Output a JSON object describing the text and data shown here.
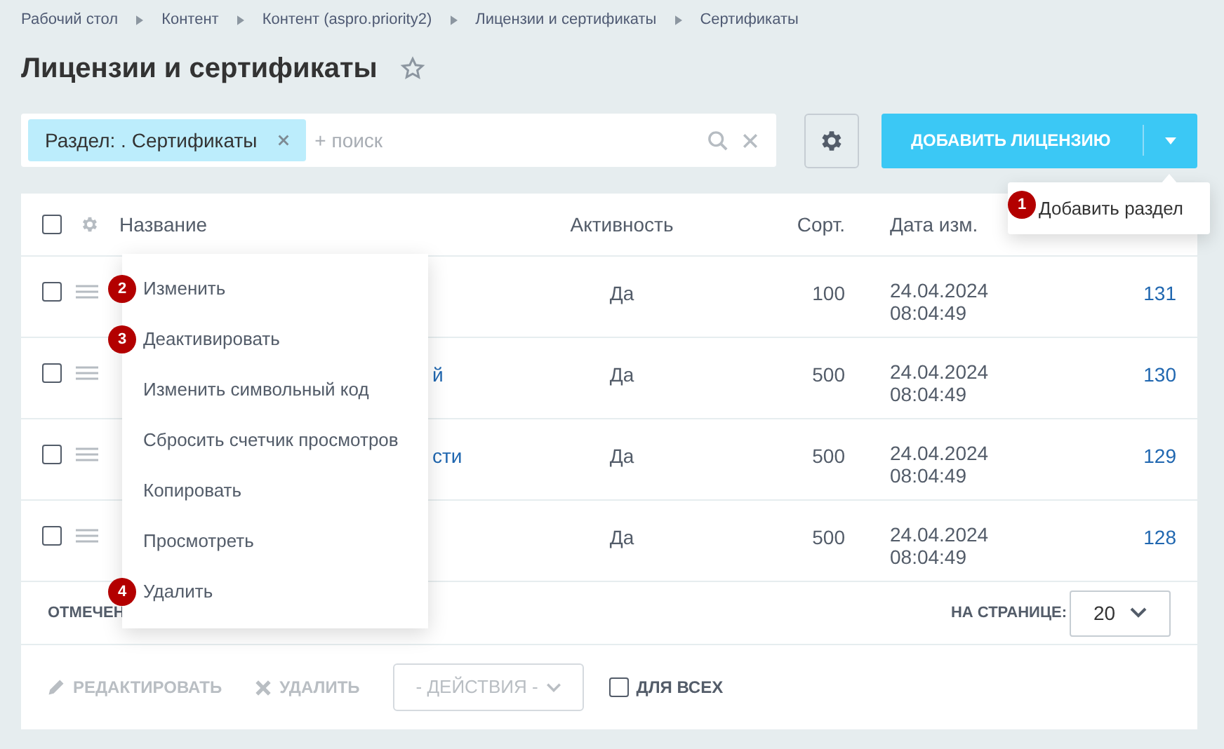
{
  "breadcrumbs": [
    "Рабочий стол",
    "Контент",
    "Контент (aspro.priority2)",
    "Лицензии и сертификаты",
    "Сертификаты"
  ],
  "title": "Лицензии и сертификаты",
  "filter": {
    "tag": "Раздел: . Сертификаты",
    "placeholder": "+ поиск"
  },
  "add_button": {
    "label": "ДОБАВИТЬ ЛИЦЕНЗИЮ"
  },
  "add_menu": [
    {
      "label": "Добавить раздел",
      "badge": "1"
    }
  ],
  "table": {
    "columns": [
      "Название",
      "Активность",
      "Сорт.",
      "Дата изм."
    ],
    "select_all": {
      "checked": false
    },
    "rows": [
      {
        "checked": false,
        "name": "",
        "active": "Да",
        "sort": "100",
        "date": "24.04.2024",
        "time": "08:04:49",
        "id": "131"
      },
      {
        "checked": false,
        "name": "й",
        "active": "Да",
        "sort": "500",
        "date": "24.04.2024",
        "time": "08:04:49",
        "id": "130"
      },
      {
        "checked": false,
        "name": "сти",
        "active": "Да",
        "sort": "500",
        "date": "24.04.2024",
        "time": "08:04:49",
        "id": "129"
      },
      {
        "checked": false,
        "name": "",
        "active": "Да",
        "sort": "500",
        "date": "24.04.2024",
        "time": "08:04:49",
        "id": "128"
      }
    ]
  },
  "context_menu": [
    {
      "label": "Изменить",
      "badge": "2"
    },
    {
      "label": "Деактивировать",
      "badge": "3"
    },
    {
      "label": "Изменить символьный код"
    },
    {
      "label": "Сбросить счетчик просмотров"
    },
    {
      "label": "Копировать"
    },
    {
      "label": "Просмотреть"
    },
    {
      "label": "Удалить",
      "badge": "4"
    }
  ],
  "footer": {
    "selected_label": "ОТМЕЧЕН",
    "per_page_label": "НА СТРАНИЦЕ:",
    "per_page": "20"
  },
  "actions": [
    {
      "kind": "edit",
      "label": "РЕДАКТИРОВАТЬ",
      "disabled": true
    },
    {
      "kind": "delete",
      "label": "УДАЛИТЬ",
      "disabled": true
    }
  ],
  "action_select": {
    "value": "- ДЕЙСТВИЯ -"
  },
  "for_all": {
    "label": "ДЛЯ ВСЕХ",
    "checked": false
  }
}
